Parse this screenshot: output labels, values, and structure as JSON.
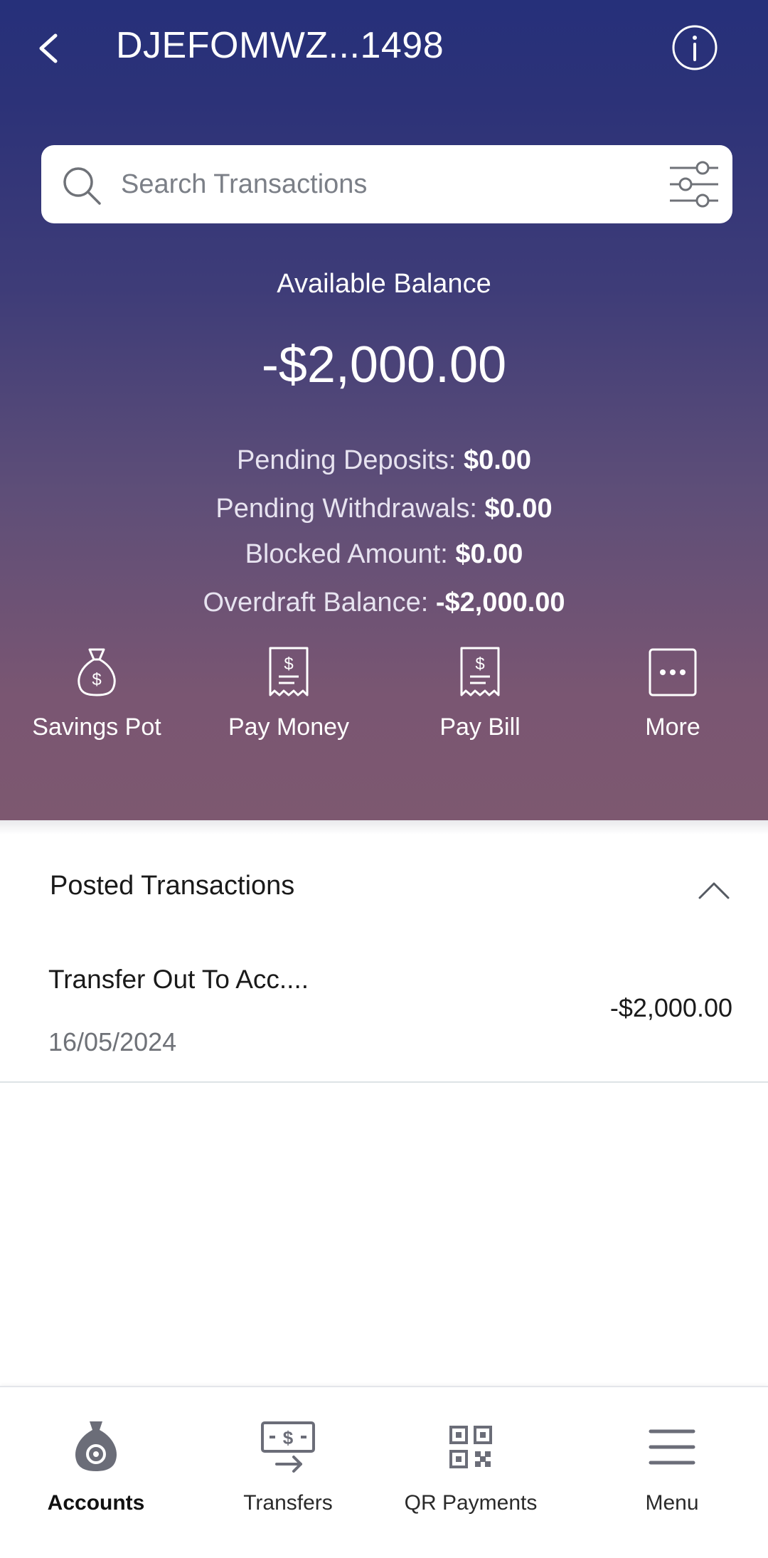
{
  "header": {
    "title": "DJEFOMWZ...1498"
  },
  "search": {
    "placeholder": "Search Transactions"
  },
  "balance": {
    "label": "Available Balance",
    "amount": "-$2,000.00"
  },
  "details": [
    {
      "label": "Pending Deposits: ",
      "value": "$0.00"
    },
    {
      "label": "Pending Withdrawals: ",
      "value": "$0.00"
    },
    {
      "label": "Blocked Amount: ",
      "value": "$0.00"
    },
    {
      "label": "Overdraft Balance: ",
      "value": "-$2,000.00"
    }
  ],
  "actions": [
    {
      "label": "Savings Pot",
      "icon": "money-bag-icon"
    },
    {
      "label": "Pay Money",
      "icon": "receipt-icon"
    },
    {
      "label": "Pay Bill",
      "icon": "receipt-icon"
    },
    {
      "label": "More",
      "icon": "more-dots-icon"
    }
  ],
  "transactions": {
    "section_title": "Posted Transactions",
    "items": [
      {
        "description": "Transfer Out To Acc....",
        "date": "16/05/2024",
        "amount": "-$2,000.00"
      }
    ]
  },
  "nav": [
    {
      "label": "Accounts",
      "icon": "money-bag-icon",
      "active": true
    },
    {
      "label": "Transfers",
      "icon": "transfer-icon",
      "active": false
    },
    {
      "label": "QR Payments",
      "icon": "qr-code-icon",
      "active": false
    },
    {
      "label": "Menu",
      "icon": "hamburger-icon",
      "active": false
    }
  ],
  "colors": {
    "header_top": "#26307a",
    "header_bottom": "#7d5870",
    "nav_icon": "#6b6d78"
  }
}
